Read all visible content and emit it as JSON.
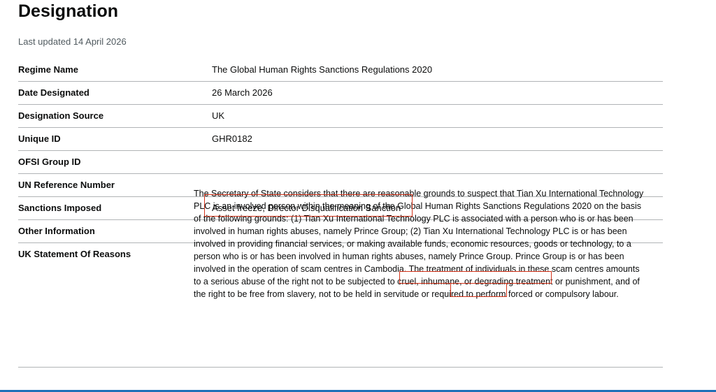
{
  "header": {
    "title": "Designation",
    "last_updated": "Last updated 14 April 2026"
  },
  "rows": [
    {
      "key": "Regime Name",
      "value": "The Global Human Rights Sanctions Regulations 2020"
    },
    {
      "key": "Date Designated",
      "value": "26 March 2026"
    },
    {
      "key": "Designation Source",
      "value": "UK"
    },
    {
      "key": "Unique ID",
      "value": "GHR0182"
    },
    {
      "key": "OFSI Group ID",
      "value": ""
    },
    {
      "key": "UN Reference Number",
      "value": ""
    },
    {
      "key": "Sanctions Imposed",
      "value": "Asset freeze, Director Disqualification Sanction"
    },
    {
      "key": "Other Information",
      "value": ""
    },
    {
      "key": "UK Statement Of Reasons",
      "value": ""
    }
  ],
  "statement": {
    "part1": "The Secretary of State considers that there are reasonable grounds to suspect that Tian Xu International Technology PLC is an involved person within the meaning of the Global Human Rights Sanctions Regulations 2020 on the basis of the following grounds: (1) ",
    "highlight1": "Tian Xu International Technology PLC",
    "part2": " is associated with a person who is or has been involved in human rights abuses, namely ",
    "highlight2": "Prince Group;",
    "part3": " (2) Tian Xu International Technology PLC is or has been involved in providing financial services, or making available funds, economic resources, goods or technology, to a person who is or has been involved in human rights abuses, namely Prince Group. Prince Group is or has been involved in the operation of scam centres in Cambodia. The treatment of individuals in these scam centres amounts to a serious abuse of the right not to be subjected to cruel, inhumane, or degrading treatment or punishment, and of the right to be free from slavery, not to be held in servitude or required to perform forced or compulsory labour."
  },
  "colors": {
    "highlight_border": "#d4351c",
    "divider": "#b1b4b6",
    "bottom_bar": "#1d70b8"
  }
}
